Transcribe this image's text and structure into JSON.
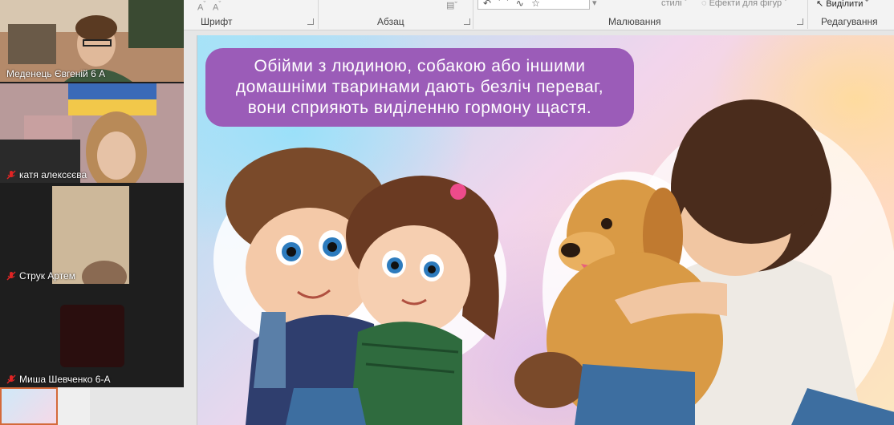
{
  "ribbon": {
    "groups": {
      "font": "Шрифт",
      "paragraph": "Абзац",
      "drawing": "Малювання",
      "editing": "Редагування"
    },
    "buttons": {
      "styles": "стилі",
      "shape_effects": "Ефекти для фігур",
      "select": "Виділити"
    },
    "shapes_gallery": "↶ ⌒ ∿ ☆"
  },
  "slide": {
    "text": "Обійми з людиною, собакою або іншими домашніми тваринами дають безліч переваг, вони сприяють виділенню гормону щастя."
  },
  "participants": [
    {
      "name": "Меденець Євгеній 6 А",
      "muted": false
    },
    {
      "name": "катя алексєєва",
      "muted": true
    },
    {
      "name": "Струк Артем",
      "muted": true
    },
    {
      "name": "Миша Шевченко 6-А",
      "muted": true
    }
  ],
  "colors": {
    "text_box": "#9b5cb8",
    "mic_off": "#e02424",
    "panel_bg": "#1e1e1e"
  }
}
